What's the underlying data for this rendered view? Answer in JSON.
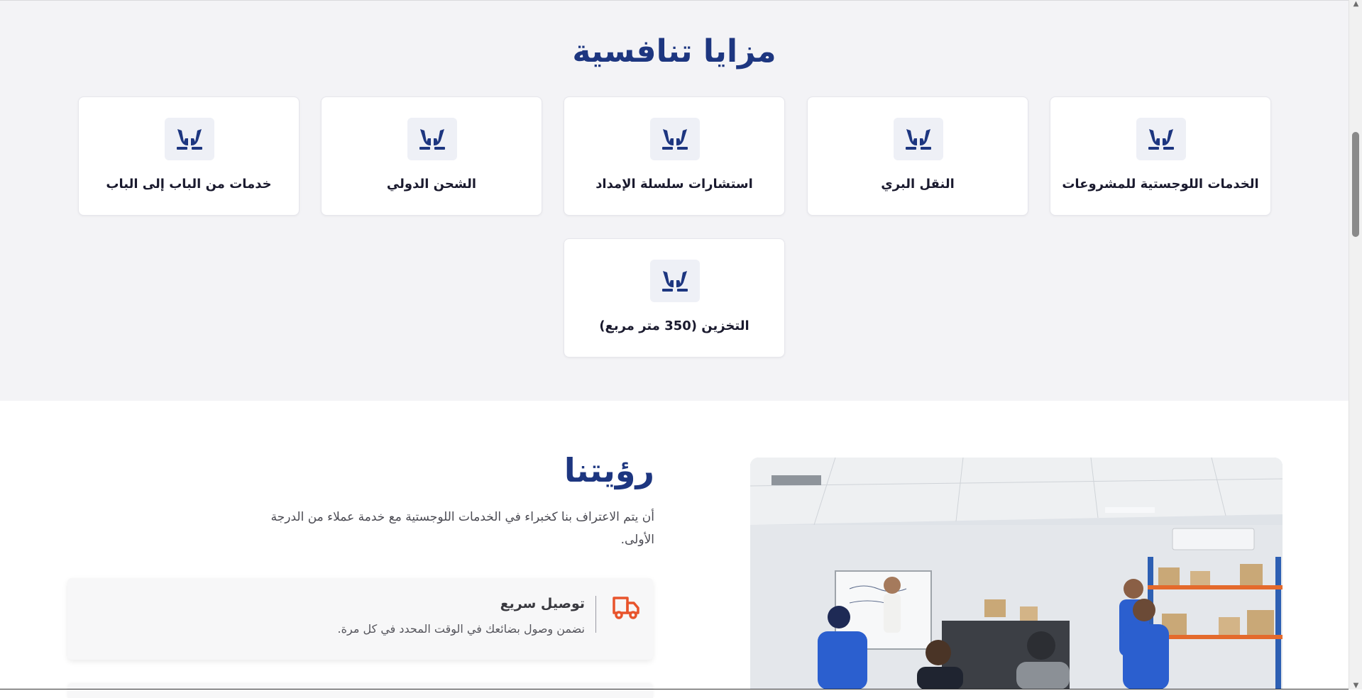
{
  "features_section": {
    "title": "مزايا تنافسية",
    "cards": [
      {
        "label": "الخدمات اللوجستية للمشروعات",
        "icon": "hands-icon"
      },
      {
        "label": "النقل البري",
        "icon": "hands-icon"
      },
      {
        "label": "استشارات سلسلة الإمداد",
        "icon": "hands-icon"
      },
      {
        "label": "الشحن الدولي",
        "icon": "hands-icon"
      },
      {
        "label": "خدمات من الباب إلى الباب",
        "icon": "hands-icon"
      },
      {
        "label": "التخزين (350 متر مربع)",
        "icon": "hands-icon"
      }
    ]
  },
  "vision_section": {
    "title": "رؤيتنا",
    "description": "أن يتم الاعتراف بنا كخبراء في الخدمات اللوجستية مع خدمة عملاء من الدرجة الأولى.",
    "photo": "team-meeting-photo",
    "features": [
      {
        "title": "توصيل سريع",
        "text": "نضمن وصول بضائعك في الوقت المحدد في كل مرة.",
        "icon": "truck-icon"
      }
    ]
  },
  "colors": {
    "brand_blue": "#1d3680",
    "accent_orange": "#e8542c",
    "section_bg": "#f3f3f6"
  }
}
